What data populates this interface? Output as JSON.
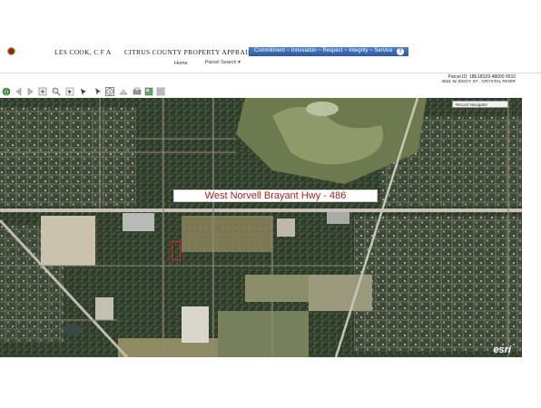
{
  "header": {
    "appraiser_name": "LES COOK, C F A",
    "organization": "CITRUS COUNTY PROPERTY APPRAISER",
    "slogan": "Commitment ~ Innovation ~ Respect ~ Integrity ~ Service",
    "help_symbol": "?"
  },
  "nav": {
    "home_label": "Home",
    "parcel_search_label": "Parcel Search ▾"
  },
  "parcel": {
    "id_text": "Parcel ID: 18E18S29 48000 0010",
    "address_text": "4531 W ZIGGY ST , CRYSTAL RIVER"
  },
  "toolbar": {
    "icons": [
      "globe-icon",
      "back-arrow-icon",
      "forward-arrow-icon",
      "zoom-in-icon",
      "zoom-out-icon",
      "select-icon",
      "pan-icon",
      "info-icon",
      "measure-icon",
      "print-icon",
      "layers-icon",
      "export-icon"
    ]
  },
  "map": {
    "record_navigator_label": "Record Navigator",
    "road_label": "West Norvell Brayant Hwy - 486",
    "esri_logo": "esri",
    "colors": {
      "highlight": "#e0202a",
      "label_text": "#b02020"
    }
  }
}
